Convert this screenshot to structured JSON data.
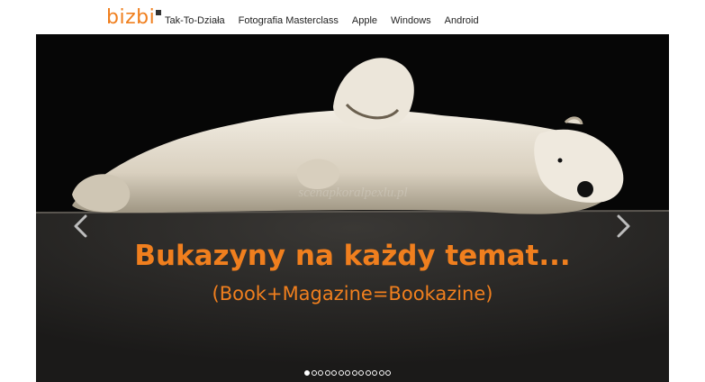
{
  "header": {
    "logo_text": "bizbi",
    "nav": [
      {
        "label": "Tak-To-Działa"
      },
      {
        "label": "Fotografia Masterclass"
      },
      {
        "label": "Apple"
      },
      {
        "label": "Windows"
      },
      {
        "label": "Android"
      }
    ]
  },
  "hero": {
    "headline": "Bukazyny na każdy temat...",
    "subheadline": "(Book+Magazine=Bookazine)",
    "watermark": "scenapkoralpexlu.pl",
    "prev_icon": "chevron-left-icon",
    "next_icon": "chevron-right-icon",
    "slide_count": 13,
    "active_slide": 1
  },
  "colors": {
    "accent": "#f07f1e",
    "hero_bg": "#050505",
    "text": "#222222"
  }
}
